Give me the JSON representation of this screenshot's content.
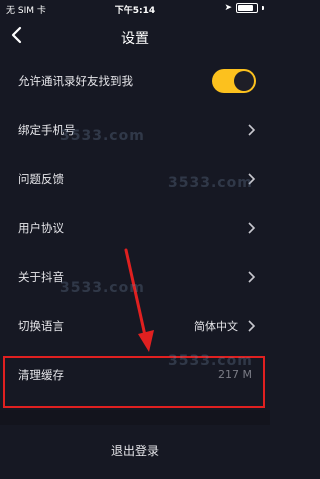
{
  "status_bar": {
    "carrier": "无 SIM 卡",
    "time": "下午5:14"
  },
  "nav": {
    "title": "设置"
  },
  "settings": {
    "allow_contacts_find_me": {
      "label": "允许通讯录好友找到我",
      "toggle_on": true
    },
    "bind_phone": {
      "label": "绑定手机号"
    },
    "feedback": {
      "label": "问题反馈"
    },
    "user_agreement": {
      "label": "用户协议"
    },
    "about": {
      "label": "关于抖音"
    },
    "language": {
      "label": "切换语言",
      "value": "简体中文"
    },
    "clear_cache": {
      "label": "清理缓存",
      "value": "217 M"
    }
  },
  "logout": {
    "label": "退出登录"
  },
  "watermark": {
    "text": "3533.com"
  },
  "colors": {
    "background": "#161823",
    "toggle_on": "#fcc11e",
    "highlight_red": "#e02020"
  }
}
